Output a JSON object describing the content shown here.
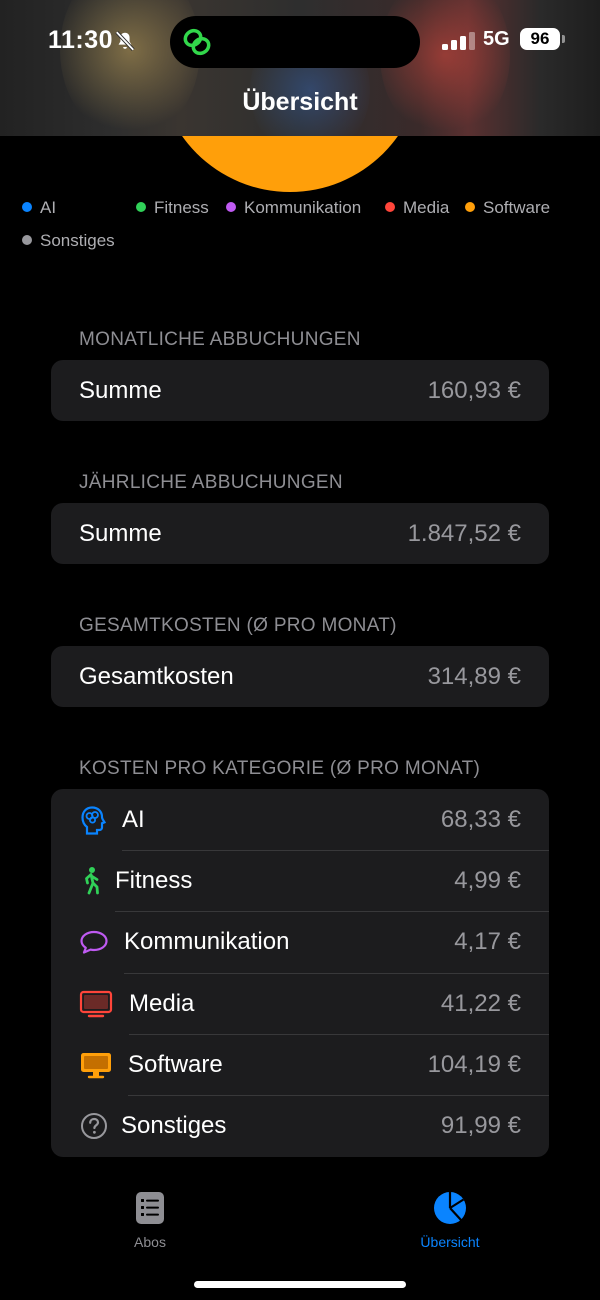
{
  "status_bar": {
    "time": "11:30",
    "network": "5G",
    "battery": "96"
  },
  "nav": {
    "title": "Übersicht"
  },
  "legend": [
    {
      "label": "AI",
      "color": "#0a84ff"
    },
    {
      "label": "Fitness",
      "color": "#30d158"
    },
    {
      "label": "Kommunikation",
      "color": "#bf5af2"
    },
    {
      "label": "Media",
      "color": "#ff453a"
    },
    {
      "label": "Software",
      "color": "#ff9f0a"
    },
    {
      "label": "Sonstiges",
      "color": "#98989d"
    }
  ],
  "sections": {
    "monthly": {
      "header": "MONATLICHE ABBUCHUNGEN",
      "label": "Summe",
      "value": "160,93 €"
    },
    "yearly": {
      "header": "JÄHRLICHE ABBUCHUNGEN",
      "label": "Summe",
      "value": "1.847,52 €"
    },
    "total": {
      "header": "GESAMTKOSTEN (Ø PRO MONAT)",
      "label": "Gesamtkosten",
      "value": "314,89 €"
    },
    "categories": {
      "header": "KOSTEN PRO KATEGORIE (Ø PRO MONAT)",
      "items": [
        {
          "label": "AI",
          "value": "68,33 €",
          "icon": "brain-head-icon"
        },
        {
          "label": "Fitness",
          "value": "4,99 €",
          "icon": "walking-figure-icon"
        },
        {
          "label": "Kommunikation",
          "value": "4,17 €",
          "icon": "speech-bubble-icon"
        },
        {
          "label": "Media",
          "value": "41,22 €",
          "icon": "tv-icon"
        },
        {
          "label": "Software",
          "value": "104,19 €",
          "icon": "desktop-icon"
        },
        {
          "label": "Sonstiges",
          "value": "91,99 €",
          "icon": "question-circle-icon"
        }
      ]
    }
  },
  "tabs": [
    {
      "label": "Abos",
      "active": false,
      "icon": "list-document-icon"
    },
    {
      "label": "Übersicht",
      "active": true,
      "icon": "pie-chart-icon"
    }
  ],
  "colors": {
    "accent": "#0a84ff",
    "inactive_tab": "#8e8e93",
    "card_bg": "#1c1c1e"
  }
}
